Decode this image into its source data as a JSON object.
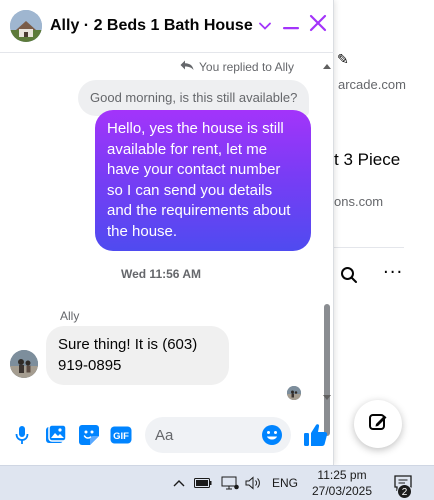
{
  "chat": {
    "title": "Ally · 2 Beds 1 Bath House",
    "replied_note": "You replied to Ally",
    "quoted_message": "Good morning, is this still available?",
    "sent_message": "Hello, yes the house is still available for rent, let me have your contact number so I can send you details and the requirements about the house.",
    "timestamp": "Wed 11:56 AM",
    "sender_name": "Ally",
    "received_message": "Sure thing! It is (603) 919-0895",
    "input_placeholder": "Aa",
    "gif_label": "GIF"
  },
  "background_page": {
    "text_arcade": "arcade.com",
    "text_piece": "t 3 Piece",
    "text_ons": "ons.com",
    "more_label": "···"
  },
  "taskbar": {
    "language": "ENG",
    "time": "11:25 pm",
    "date": "27/03/2025",
    "notification_count": "2"
  },
  "colors": {
    "accent": "#a334fa",
    "sent_gradient": [
      "#a334fa",
      "#7a3cf5",
      "#4f4bf0"
    ],
    "composer_icons": "#0084ff"
  },
  "icons": [
    "reply-arrow-icon",
    "chevron-down-icon",
    "minimize-icon",
    "close-icon",
    "microphone-icon",
    "photo-icon",
    "sticker-icon",
    "gif-icon",
    "emoji-icon",
    "thumbs-up-icon",
    "compose-icon",
    "search-icon",
    "more-icon",
    "battery-icon",
    "network-icon",
    "volume-icon",
    "notification-icon"
  ]
}
